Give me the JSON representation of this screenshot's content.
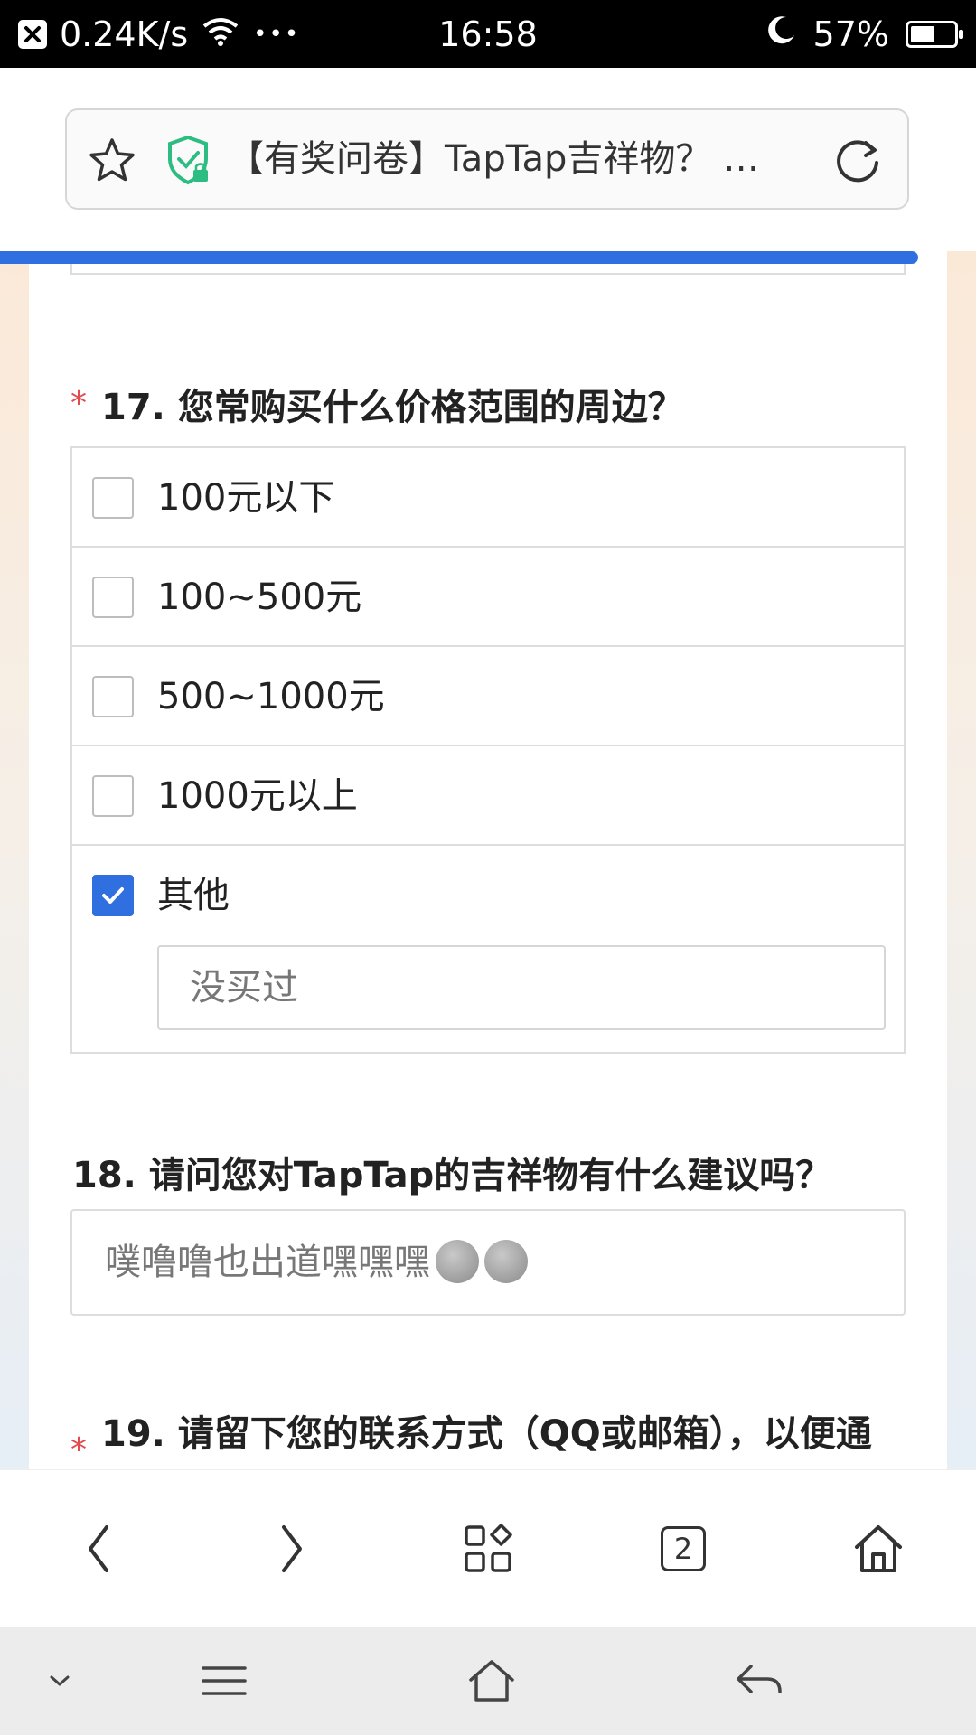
{
  "status_bar": {
    "speed": "0.24K/s",
    "dots": "•••",
    "time": "16:58",
    "battery": "57%",
    "battery_level": 0.57
  },
  "address_bar": {
    "title": "【有奖问卷】TapTap吉祥物？ …"
  },
  "questions": {
    "q17": {
      "required_mark": "*",
      "title": "17. 您常购买什么价格范围的周边？",
      "options": [
        {
          "label": "100元以下",
          "checked": false
        },
        {
          "label": "100~500元",
          "checked": false
        },
        {
          "label": "500~1000元",
          "checked": false
        },
        {
          "label": "1000元以上",
          "checked": false
        },
        {
          "label": "其他",
          "checked": true
        }
      ],
      "other_value": "没买过"
    },
    "q18": {
      "title": "18. 请问您对TapTap的吉祥物有什么建议吗？",
      "answer": "噗噜噜也出道嘿嘿嘿"
    },
    "q19": {
      "required_mark": "*",
      "title": "19. 请留下您的联系方式（QQ或邮箱），以便通"
    }
  },
  "toolbar": {
    "tab_count": "2"
  }
}
